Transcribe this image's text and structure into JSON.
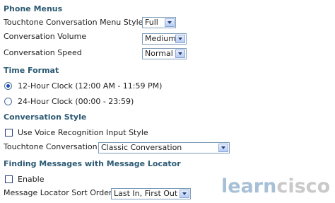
{
  "phone_menus": {
    "heading": "Phone Menus",
    "touchtone_style": {
      "label": "Touchtone Conversation Menu Style",
      "value": "Full"
    },
    "volume": {
      "label": "Conversation Volume",
      "value": "Medium"
    },
    "speed": {
      "label": "Conversation Speed",
      "value": "Normal"
    }
  },
  "time_format": {
    "heading": "Time Format",
    "options": [
      {
        "label": "12-Hour Clock (12:00 AM - 11:59 PM)",
        "selected": true
      },
      {
        "label": "24-Hour Clock (00:00 - 23:59)",
        "selected": false
      }
    ]
  },
  "conversation_style": {
    "heading": "Conversation Style",
    "voice_recognition": {
      "label": "Use Voice Recognition Input Style",
      "checked": false
    },
    "touchtone_conversation": {
      "label": "Touchtone Conversation",
      "value": "Classic Conversation"
    }
  },
  "message_locator": {
    "heading": "Finding Messages with Message Locator",
    "enable": {
      "label": "Enable",
      "checked": false
    },
    "sort_order": {
      "label": "Message Locator Sort Order",
      "value": "Last In, First Out"
    }
  },
  "watermark": {
    "part1": "learn",
    "part2": "cisco"
  }
}
